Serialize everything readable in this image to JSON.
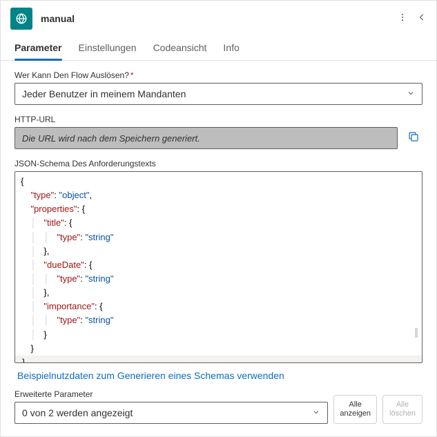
{
  "header": {
    "title": "manual"
  },
  "tabs": [
    {
      "label": "Parameter",
      "active": true
    },
    {
      "label": "Einstellungen",
      "active": false
    },
    {
      "label": "Codeansicht",
      "active": false
    },
    {
      "label": "Info",
      "active": false
    }
  ],
  "trigger": {
    "label": "Wer Kann Den Flow Auslösen?",
    "required": "*",
    "value": "Jeder Benutzer in meinem Mandanten"
  },
  "http_url": {
    "label": "HTTP-URL",
    "placeholder": "Die URL wird nach dem Speichern generiert."
  },
  "schema": {
    "label": "JSON-Schema Des Anforderungstexts",
    "json": {
      "type": "object",
      "properties": {
        "title": {
          "type": "string"
        },
        "dueDate": {
          "type": "string"
        },
        "importance": {
          "type": "string"
        }
      }
    },
    "sample_link": "Beispielnutzdaten zum Generieren eines Schemas verwenden"
  },
  "advanced": {
    "label": "Erweiterte Parameter",
    "value": "0 von 2 werden angezeigt",
    "show_all_l1": "Alle",
    "show_all_l2": "anzeigen",
    "clear_all_l1": "Alle",
    "clear_all_l2": "löschen"
  }
}
